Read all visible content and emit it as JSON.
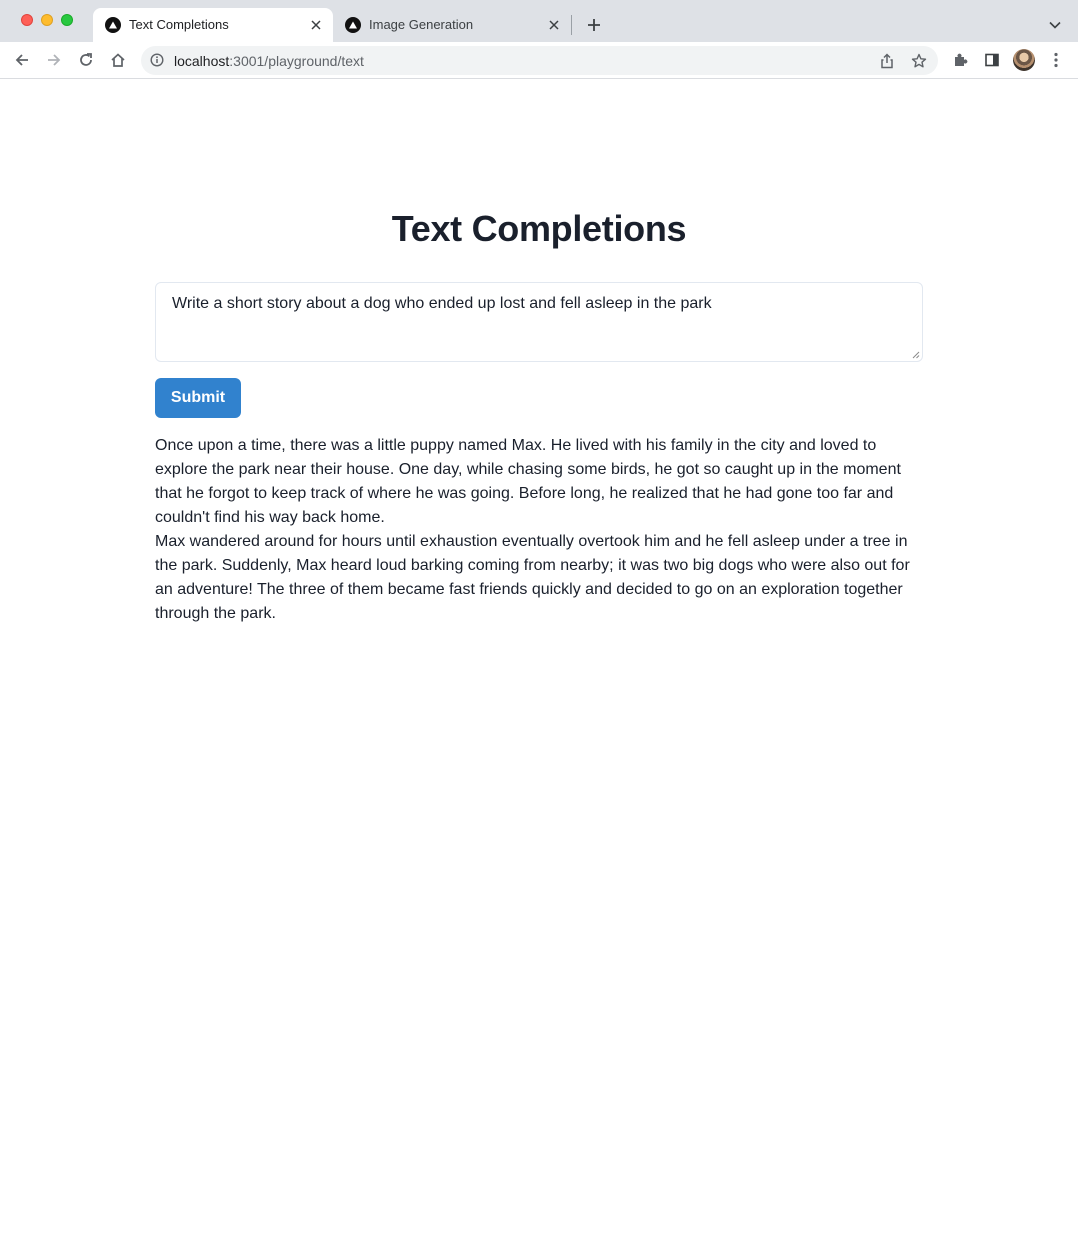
{
  "browser": {
    "tabs": [
      {
        "title": "Text Completions",
        "active": true,
        "favicon": "triangle-logo-icon"
      },
      {
        "title": "Image Generation",
        "active": false,
        "favicon": "triangle-logo-icon"
      }
    ],
    "url": {
      "host": "localhost",
      "path": ":3001/playground/text"
    }
  },
  "page": {
    "title": "Text Completions",
    "prompt": {
      "value": "Write a short story about a dog who ended up lost and fell asleep in the park"
    },
    "submit_label": "Submit",
    "output": [
      "Once upon a time, there was a little puppy named Max. He lived with his family in the city and loved to explore the park near their house. One day, while chasing some birds, he got so caught up in the moment that he forgot to keep track of where he was going. Before long, he realized that he had gone too far and couldn't find his way back home.",
      "Max wandered around for hours until exhaustion eventually overtook him and he fell asleep under a tree in the park. Suddenly, Max heard loud barking coming from nearby; it was two big dogs who were also out for an adventure! The three of them became fast friends quickly and decided to go on an exploration together through the park."
    ]
  },
  "colors": {
    "accent": "#3182ce",
    "heading": "#1a202c",
    "tabstrip": "#dee1e6"
  }
}
